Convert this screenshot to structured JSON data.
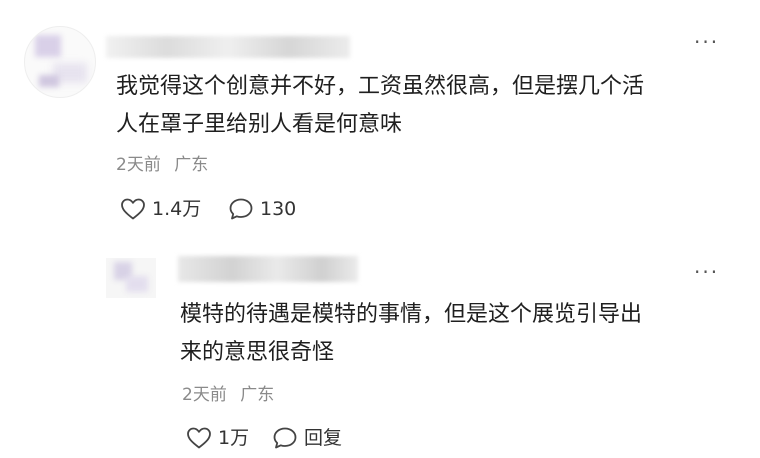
{
  "comment": {
    "text_line1": "我觉得这个创意并不好，工资虽然很高，但是摆几个活",
    "text_line2": "人在罩子里给别人看是何意味",
    "time": "2天前",
    "location": "广东",
    "likes": "1.4万",
    "replies": "130",
    "icons": {
      "like": "heart-outline-icon",
      "reply": "speech-bubble-icon",
      "more": "more-dots-icon"
    }
  },
  "reply": {
    "text_line1": "模特的待遇是模特的事情，但是这个展览引导出",
    "text_line2": "来的意思很奇怪",
    "time": "2天前",
    "location": "广东",
    "likes": "1万",
    "reply_label": "回复",
    "icons": {
      "like": "heart-outline-icon",
      "reply": "speech-bubble-icon",
      "more": "more-dots-icon"
    }
  },
  "more_glyph": "···"
}
